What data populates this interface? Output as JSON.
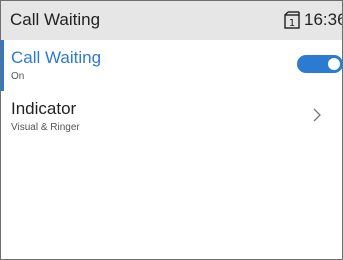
{
  "header": {
    "title": "Call Waiting",
    "time": "16:36",
    "status_icon": "phone-line-icon"
  },
  "menu": {
    "items": [
      {
        "label": "Call Waiting",
        "sublabel": "On",
        "control": "toggle",
        "toggle_state": "on",
        "selected": true
      },
      {
        "label": "Indicator",
        "sublabel": "Visual & Ringer",
        "control": "chevron-right-icon",
        "selected": false
      }
    ]
  },
  "colors": {
    "accent": "#2b7bd3",
    "header_bg": "#e6e6e6",
    "background": "#ffffff",
    "text": "#222222"
  }
}
